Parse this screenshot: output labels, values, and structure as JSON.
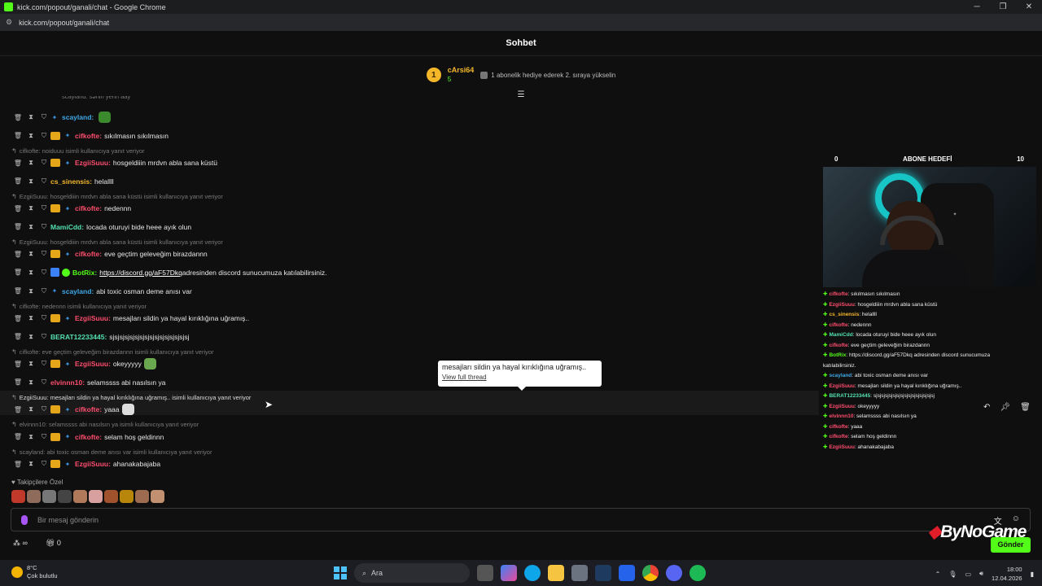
{
  "window": {
    "title": "kick.com/popout/ganali/chat - Google Chrome",
    "url": "kick.com/popout/ganali/chat"
  },
  "header": {
    "title": "Sohbet"
  },
  "pinned": {
    "rank": "1",
    "user": "cArsi64",
    "count": "5",
    "goal_text": "1 abonelik hediye ederek 2. sıraya yükselin"
  },
  "chat": {
    "top_partial": "scayland: sənin yerin aay",
    "rows": [
      {
        "type": "msg",
        "user": "scayland",
        "color": "#3fa8e6",
        "text": "",
        "badges": "sub",
        "emote": "#3c8a2e"
      },
      {
        "type": "msg",
        "user": "cifkofte",
        "color": "#ff4d6d",
        "text": "sıkılmasın sıkılmasın",
        "badges": "crown-sub"
      },
      {
        "type": "reply",
        "text": "cifkofte: noiduuu isimli kullanıcıya yanıt veriyor"
      },
      {
        "type": "msg",
        "user": "EzgiiSuuu",
        "color": "#ff4d6d",
        "text": "hosgeldiiin mrdvn abla sana küstü",
        "badges": "crown-sub"
      },
      {
        "type": "msg",
        "user": "cs_sinensis",
        "color": "#f4b72a",
        "text": "helallll",
        "badges": ""
      },
      {
        "type": "reply",
        "text": "EzgiiSuuu: hosgeldiiin mrdvn abla sana küstü isimli kullanıcıya yanıt veriyor"
      },
      {
        "type": "msg",
        "user": "cifkofte",
        "color": "#ff4d6d",
        "text": "nedennn",
        "badges": "crown-sub"
      },
      {
        "type": "msg",
        "user": "MamiCdd",
        "color": "#53e0b0",
        "text": "locada oturuyi bide heee ayık olun",
        "badges": ""
      },
      {
        "type": "reply",
        "text": "EzgiiSuuu: hosgeldiiin mrdvn abla sana küstü isimli kullanıcıya yanıt veriyor"
      },
      {
        "type": "msg",
        "user": "cifkofte",
        "color": "#ff4d6d",
        "text": "eve geçtim geleveğim birazdannn",
        "badges": "crown-sub"
      },
      {
        "type": "bot",
        "user": "BotRix",
        "color": "#53fc18",
        "link": "https://discord.gg/aF57Dkq",
        "text": "adresinden discord sunucumuza katılabilirsiniz."
      },
      {
        "type": "msg",
        "user": "scayland",
        "color": "#3fa8e6",
        "text": "abi toxic osman deme anısı var",
        "badges": "sub"
      },
      {
        "type": "reply",
        "text": "cifkofte: nedennn isimli kullanıcıya yanıt veriyor"
      },
      {
        "type": "msg",
        "user": "EzgiiSuuu",
        "color": "#ff4d6d",
        "text": "mesajları sildin ya hayal kırıklığına uğramış..",
        "badges": "crown-sub"
      },
      {
        "type": "msg",
        "user": "BERAT12233445",
        "color": "#53e0b0",
        "text": "sjsjsjsjsjsjsjsjsjsjsjsjsjsjsjsj",
        "badges": ""
      },
      {
        "type": "reply",
        "text": "cifkofte: eve geçtim geleveğim birazdannn isimli kullanıcıya yanıt veriyor"
      },
      {
        "type": "msg",
        "user": "EzgiiSuuu",
        "color": "#ff4d6d",
        "text": "okeyyyyy",
        "badges": "crown-sub",
        "emote": "#6aa84f"
      },
      {
        "type": "msg",
        "user": "elvinnn10",
        "color": "#ff4d6d",
        "text": "selamssss abi nasılsın ya",
        "badges": ""
      },
      {
        "type": "reply-hl",
        "text": "EzgiiSuuu: mesajları sildin ya hayal kırıklığına uğramış.. isimli kullanıcıya yanıt veriyor"
      },
      {
        "type": "msg",
        "user": "cifkofte",
        "color": "#ff4d6d",
        "text": "yaaa",
        "badges": "crown-sub",
        "emote": "#ddd"
      },
      {
        "type": "reply",
        "text": "elvinnn10: selamssss abi nasılsın ya isimli kullanıcıya yanıt veriyor"
      },
      {
        "type": "msg",
        "user": "cifkofte",
        "color": "#ff4d6d",
        "text": "selam hoş geldinnn",
        "badges": "crown-sub"
      },
      {
        "type": "reply",
        "text": "scayland: abi toxic osman deme anısı var isimli kullanıcıya yanıt veriyor"
      },
      {
        "type": "msg",
        "user": "EzgiiSuuu",
        "color": "#ff4d6d",
        "text": "ahanakabajaba",
        "badges": "crown-sub"
      }
    ]
  },
  "tooltip": {
    "text": "mesajları sildin ya hayal kırıklığına uğramış..",
    "link": "View full thread"
  },
  "followers_label": "Takipçilere Özel",
  "input": {
    "placeholder": "Bir mesaj gönderin"
  },
  "bottom": {
    "infinity": "∞",
    "count": "0",
    "send": "Gönder"
  },
  "overlay": {
    "goal_left": "0",
    "goal_title": "ABONE HEDEFİ",
    "goal_right": "10",
    "chat": [
      {
        "u": "cifkofte",
        "c": "#ff4d6d",
        "t": ": sıkılmasın sıkılmasın"
      },
      {
        "u": "EzgiiSuuu",
        "c": "#ff4d6d",
        "t": ": hosgeldiiin mrdvn abla sana küstü"
      },
      {
        "u": "cs_sinensis",
        "c": "#f4b72a",
        "t": ": helallll"
      },
      {
        "u": "cifkofte",
        "c": "#ff4d6d",
        "t": ": nedennn"
      },
      {
        "u": "MamiCdd",
        "c": "#53e0b0",
        "t": ": locada oturuyi bide heee ayık olun"
      },
      {
        "u": "cifkofte",
        "c": "#ff4d6d",
        "t": ": eve geçtim geleveğim birazdannn"
      },
      {
        "u": "BotRix",
        "c": "#53fc18",
        "t": ": https://discord.gg/aF57Dkq adresinden discord sunucumuza"
      },
      {
        "u": "",
        "c": "#ddd",
        "t": "katılabilirsiniz."
      },
      {
        "u": "scayland",
        "c": "#3fa8e6",
        "t": ": abi toxic osman deme anısı var"
      },
      {
        "u": "EzgiiSuuu",
        "c": "#ff4d6d",
        "t": ": mesajları sildin ya hayal kırıklığına uğramış.."
      },
      {
        "u": "BERAT12233445",
        "c": "#53e0b0",
        "t": ": sjsjsjsjsjsjsjsjsjsjsjsjsjsjsjsj"
      },
      {
        "u": "EzgiiSuuu",
        "c": "#ff4d6d",
        "t": ": okeyyyyy"
      },
      {
        "u": "elvinnn10",
        "c": "#ff4d6d",
        "t": ": selamssss abi nasılsın ya"
      },
      {
        "u": "cifkofte",
        "c": "#ff4d6d",
        "t": ": yaaa"
      },
      {
        "u": "cifkofte",
        "c": "#ff4d6d",
        "t": ": selam hoş geldinnn"
      },
      {
        "u": "EzgiiSuuu",
        "c": "#ff4d6d",
        "t": ": ahanakabajaba"
      }
    ]
  },
  "brand": {
    "name": "ByNoGame"
  },
  "taskbar": {
    "temp": "8°C",
    "weather": "Çok bulutlu",
    "search": "Ara",
    "time": "18:00",
    "date": "12.04.2026"
  }
}
